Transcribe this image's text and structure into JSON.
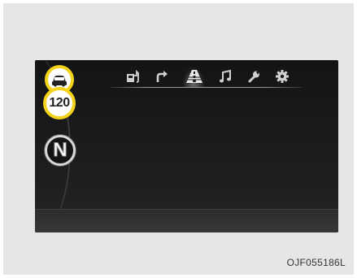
{
  "cluster": {
    "speed_limit": "120",
    "gear": "N",
    "car_icon": "vehicle-distance-icon"
  },
  "menu": {
    "tabs": [
      {
        "icon": "driving-info-icon"
      },
      {
        "icon": "turn-by-turn-arrow-icon"
      },
      {
        "icon": "driver-assistance-road-icon",
        "active": true
      },
      {
        "icon": "music-note-icon"
      },
      {
        "icon": "wrench-icon"
      },
      {
        "icon": "gear-icon"
      }
    ]
  },
  "figure_code": "OJF055186L",
  "colors": {
    "badge_ring": "#f2d21a",
    "screen": "#1a1a1a",
    "icon": "#d0d0d0"
  }
}
